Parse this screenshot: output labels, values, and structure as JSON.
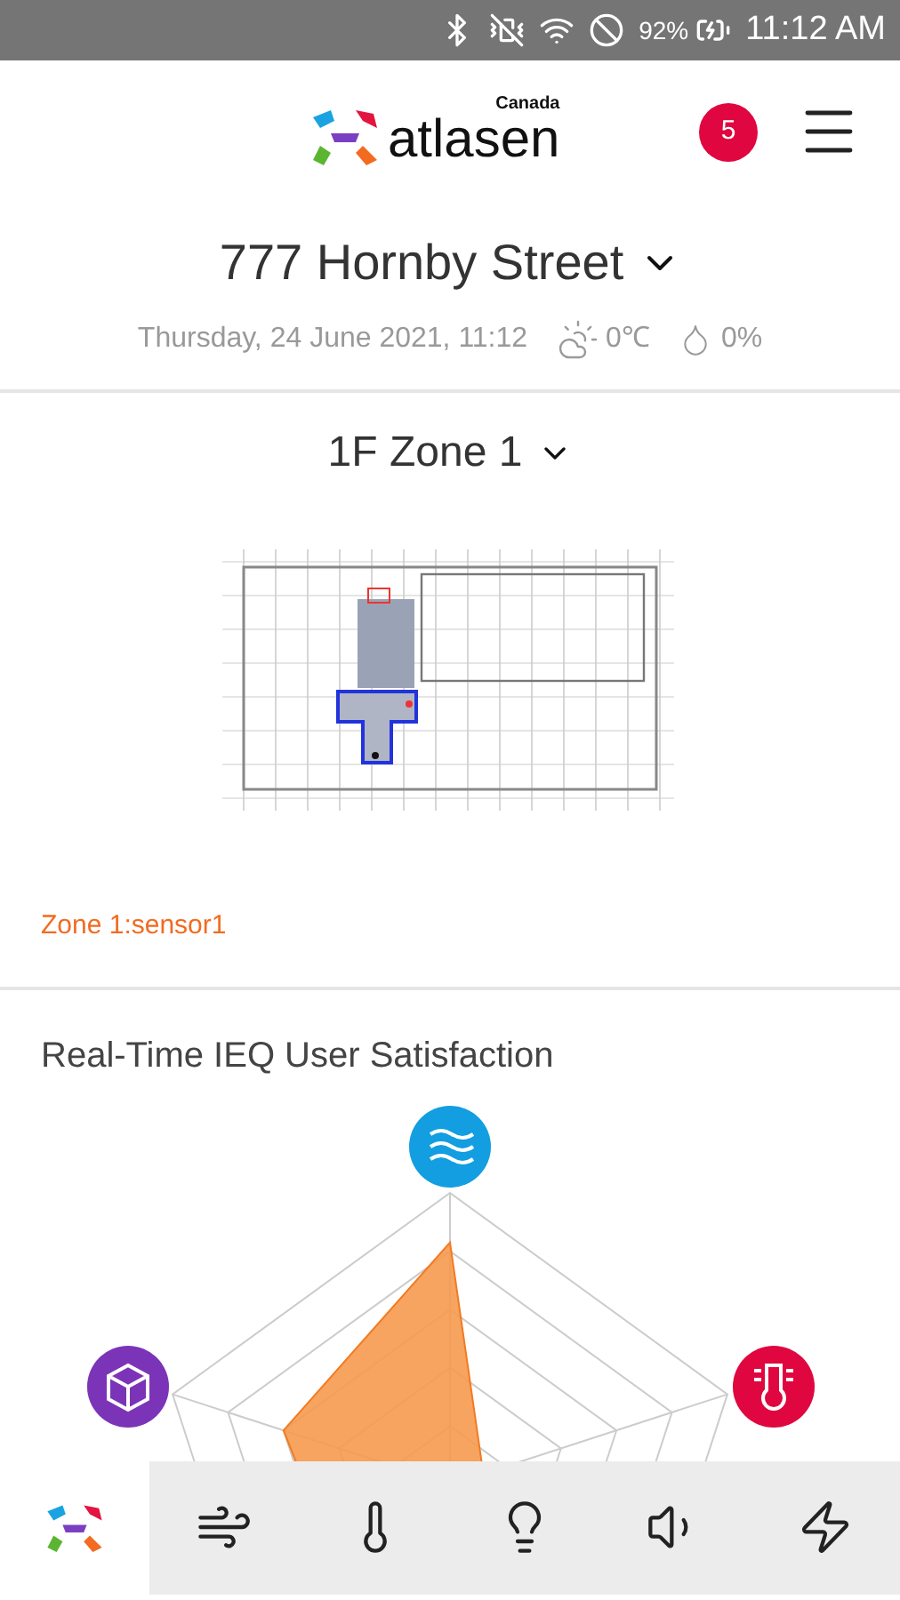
{
  "status_bar": {
    "battery": "92%",
    "time": "11:12 AM"
  },
  "header": {
    "logo_text": "atlasen",
    "logo_region": "Canada",
    "notification_count": "5"
  },
  "building": {
    "name": "777 Hornby Street"
  },
  "conditions": {
    "datetime": "Thursday, 24 June 2021, 11:12",
    "temperature": "0℃",
    "humidity": "0%"
  },
  "zone": {
    "name": "1F Zone 1",
    "sensor": "Zone 1:sensor1"
  },
  "satisfaction": {
    "title": "Real-Time IEQ User Satisfaction"
  },
  "bottom_nav": [
    {
      "kind": "home",
      "selected": true
    },
    {
      "kind": "air",
      "selected": false
    },
    {
      "kind": "thermal",
      "selected": false
    },
    {
      "kind": "light",
      "selected": false
    },
    {
      "kind": "sound",
      "selected": false
    },
    {
      "kind": "energy",
      "selected": false
    }
  ]
}
